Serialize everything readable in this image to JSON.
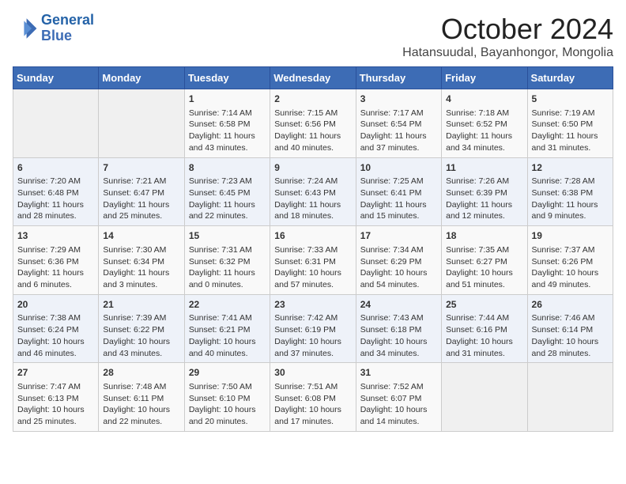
{
  "header": {
    "logo_line1": "General",
    "logo_line2": "Blue",
    "month": "October 2024",
    "location": "Hatansuudal, Bayanhongor, Mongolia"
  },
  "days_of_week": [
    "Sunday",
    "Monday",
    "Tuesday",
    "Wednesday",
    "Thursday",
    "Friday",
    "Saturday"
  ],
  "weeks": [
    [
      {
        "day": "",
        "empty": true
      },
      {
        "day": "",
        "empty": true
      },
      {
        "day": "1",
        "sunrise": "Sunrise: 7:14 AM",
        "sunset": "Sunset: 6:58 PM",
        "daylight": "Daylight: 11 hours and 43 minutes."
      },
      {
        "day": "2",
        "sunrise": "Sunrise: 7:15 AM",
        "sunset": "Sunset: 6:56 PM",
        "daylight": "Daylight: 11 hours and 40 minutes."
      },
      {
        "day": "3",
        "sunrise": "Sunrise: 7:17 AM",
        "sunset": "Sunset: 6:54 PM",
        "daylight": "Daylight: 11 hours and 37 minutes."
      },
      {
        "day": "4",
        "sunrise": "Sunrise: 7:18 AM",
        "sunset": "Sunset: 6:52 PM",
        "daylight": "Daylight: 11 hours and 34 minutes."
      },
      {
        "day": "5",
        "sunrise": "Sunrise: 7:19 AM",
        "sunset": "Sunset: 6:50 PM",
        "daylight": "Daylight: 11 hours and 31 minutes."
      }
    ],
    [
      {
        "day": "6",
        "sunrise": "Sunrise: 7:20 AM",
        "sunset": "Sunset: 6:48 PM",
        "daylight": "Daylight: 11 hours and 28 minutes."
      },
      {
        "day": "7",
        "sunrise": "Sunrise: 7:21 AM",
        "sunset": "Sunset: 6:47 PM",
        "daylight": "Daylight: 11 hours and 25 minutes."
      },
      {
        "day": "8",
        "sunrise": "Sunrise: 7:23 AM",
        "sunset": "Sunset: 6:45 PM",
        "daylight": "Daylight: 11 hours and 22 minutes."
      },
      {
        "day": "9",
        "sunrise": "Sunrise: 7:24 AM",
        "sunset": "Sunset: 6:43 PM",
        "daylight": "Daylight: 11 hours and 18 minutes."
      },
      {
        "day": "10",
        "sunrise": "Sunrise: 7:25 AM",
        "sunset": "Sunset: 6:41 PM",
        "daylight": "Daylight: 11 hours and 15 minutes."
      },
      {
        "day": "11",
        "sunrise": "Sunrise: 7:26 AM",
        "sunset": "Sunset: 6:39 PM",
        "daylight": "Daylight: 11 hours and 12 minutes."
      },
      {
        "day": "12",
        "sunrise": "Sunrise: 7:28 AM",
        "sunset": "Sunset: 6:38 PM",
        "daylight": "Daylight: 11 hours and 9 minutes."
      }
    ],
    [
      {
        "day": "13",
        "sunrise": "Sunrise: 7:29 AM",
        "sunset": "Sunset: 6:36 PM",
        "daylight": "Daylight: 11 hours and 6 minutes."
      },
      {
        "day": "14",
        "sunrise": "Sunrise: 7:30 AM",
        "sunset": "Sunset: 6:34 PM",
        "daylight": "Daylight: 11 hours and 3 minutes."
      },
      {
        "day": "15",
        "sunrise": "Sunrise: 7:31 AM",
        "sunset": "Sunset: 6:32 PM",
        "daylight": "Daylight: 11 hours and 0 minutes."
      },
      {
        "day": "16",
        "sunrise": "Sunrise: 7:33 AM",
        "sunset": "Sunset: 6:31 PM",
        "daylight": "Daylight: 10 hours and 57 minutes."
      },
      {
        "day": "17",
        "sunrise": "Sunrise: 7:34 AM",
        "sunset": "Sunset: 6:29 PM",
        "daylight": "Daylight: 10 hours and 54 minutes."
      },
      {
        "day": "18",
        "sunrise": "Sunrise: 7:35 AM",
        "sunset": "Sunset: 6:27 PM",
        "daylight": "Daylight: 10 hours and 51 minutes."
      },
      {
        "day": "19",
        "sunrise": "Sunrise: 7:37 AM",
        "sunset": "Sunset: 6:26 PM",
        "daylight": "Daylight: 10 hours and 49 minutes."
      }
    ],
    [
      {
        "day": "20",
        "sunrise": "Sunrise: 7:38 AM",
        "sunset": "Sunset: 6:24 PM",
        "daylight": "Daylight: 10 hours and 46 minutes."
      },
      {
        "day": "21",
        "sunrise": "Sunrise: 7:39 AM",
        "sunset": "Sunset: 6:22 PM",
        "daylight": "Daylight: 10 hours and 43 minutes."
      },
      {
        "day": "22",
        "sunrise": "Sunrise: 7:41 AM",
        "sunset": "Sunset: 6:21 PM",
        "daylight": "Daylight: 10 hours and 40 minutes."
      },
      {
        "day": "23",
        "sunrise": "Sunrise: 7:42 AM",
        "sunset": "Sunset: 6:19 PM",
        "daylight": "Daylight: 10 hours and 37 minutes."
      },
      {
        "day": "24",
        "sunrise": "Sunrise: 7:43 AM",
        "sunset": "Sunset: 6:18 PM",
        "daylight": "Daylight: 10 hours and 34 minutes."
      },
      {
        "day": "25",
        "sunrise": "Sunrise: 7:44 AM",
        "sunset": "Sunset: 6:16 PM",
        "daylight": "Daylight: 10 hours and 31 minutes."
      },
      {
        "day": "26",
        "sunrise": "Sunrise: 7:46 AM",
        "sunset": "Sunset: 6:14 PM",
        "daylight": "Daylight: 10 hours and 28 minutes."
      }
    ],
    [
      {
        "day": "27",
        "sunrise": "Sunrise: 7:47 AM",
        "sunset": "Sunset: 6:13 PM",
        "daylight": "Daylight: 10 hours and 25 minutes."
      },
      {
        "day": "28",
        "sunrise": "Sunrise: 7:48 AM",
        "sunset": "Sunset: 6:11 PM",
        "daylight": "Daylight: 10 hours and 22 minutes."
      },
      {
        "day": "29",
        "sunrise": "Sunrise: 7:50 AM",
        "sunset": "Sunset: 6:10 PM",
        "daylight": "Daylight: 10 hours and 20 minutes."
      },
      {
        "day": "30",
        "sunrise": "Sunrise: 7:51 AM",
        "sunset": "Sunset: 6:08 PM",
        "daylight": "Daylight: 10 hours and 17 minutes."
      },
      {
        "day": "31",
        "sunrise": "Sunrise: 7:52 AM",
        "sunset": "Sunset: 6:07 PM",
        "daylight": "Daylight: 10 hours and 14 minutes."
      },
      {
        "day": "",
        "empty": true
      },
      {
        "day": "",
        "empty": true
      }
    ]
  ]
}
